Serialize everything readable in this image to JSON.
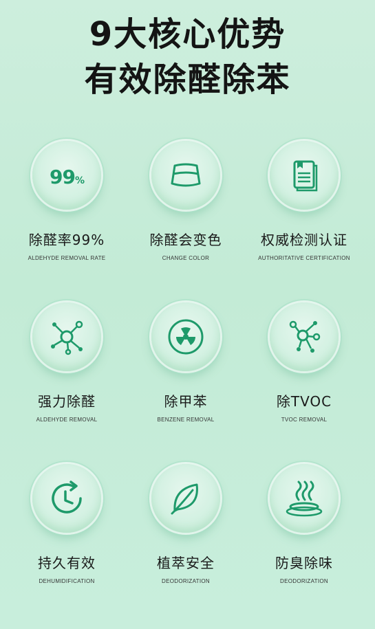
{
  "headline": {
    "line1": "9大核心优势",
    "line2": "有效除醛除苯"
  },
  "features": [
    {
      "title": "除醛率99%",
      "subtitle": "ALDEHYDE REMOVAL RATE",
      "icon": "percent-99-icon",
      "icon_text": "99",
      "icon_text_small": "%"
    },
    {
      "title": "除醛会变色",
      "subtitle": "CHANGE COLOR",
      "icon": "color-change-card-icon"
    },
    {
      "title": "权威检测认证",
      "subtitle": "AUTHORITATIVE CERTIFICATION",
      "icon": "document-icon"
    },
    {
      "title": "强力除醛",
      "subtitle": "ALDEHYDE REMOVAL",
      "icon": "molecule-icon"
    },
    {
      "title": "除甲苯",
      "subtitle": "BENZENE REMOVAL",
      "icon": "radiation-icon"
    },
    {
      "title": "除TVOC",
      "subtitle": "TVOC REMOVAL",
      "icon": "molecule-icon"
    },
    {
      "title": "持久有效",
      "subtitle": "DEHUMIDIFICATION",
      "icon": "clock-icon"
    },
    {
      "title": "植萃安全",
      "subtitle": "DEODORIZATION",
      "icon": "leaf-icon"
    },
    {
      "title": "防臭除味",
      "subtitle": "DEODORIZATION",
      "icon": "steam-icon"
    }
  ],
  "colors": {
    "accent": "#1e9a6a",
    "background": "#c6ecd8",
    "text": "#141414"
  }
}
